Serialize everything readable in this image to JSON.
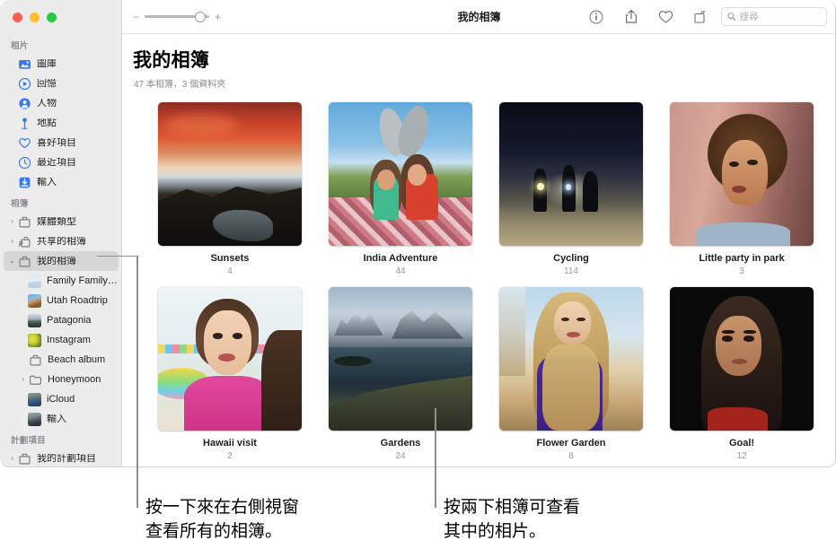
{
  "window": {
    "traffic_lights": [
      "close",
      "minimize",
      "zoom"
    ]
  },
  "toolbar": {
    "zoom_minus": "−",
    "zoom_plus": "+",
    "title": "我的相簿",
    "info_label": "info",
    "share_label": "share",
    "favorite_label": "favorite",
    "rotate_label": "rotate",
    "search_placeholder": "搜尋",
    "search_value": ""
  },
  "sidebar": {
    "sections": [
      {
        "header": "相片",
        "items": [
          {
            "label": "圖庫",
            "icon": "library-icon",
            "triangle": "",
            "selected": false
          },
          {
            "label": "回憶",
            "icon": "memories-icon",
            "triangle": "",
            "selected": false
          },
          {
            "label": "人物",
            "icon": "people-icon",
            "triangle": "",
            "selected": false
          },
          {
            "label": "地點",
            "icon": "places-icon",
            "triangle": "",
            "selected": false
          },
          {
            "label": "喜好項目",
            "icon": "heart-icon",
            "triangle": "",
            "selected": false
          },
          {
            "label": "最近項目",
            "icon": "clock-icon",
            "triangle": "",
            "selected": false
          },
          {
            "label": "輸入",
            "icon": "import-icon",
            "triangle": "",
            "selected": false
          }
        ]
      },
      {
        "header": "相簿",
        "items": [
          {
            "label": "媒體類型",
            "icon": "album-outline-icon",
            "triangle": "›",
            "selected": false
          },
          {
            "label": "共享的相簿",
            "icon": "shared-album-icon",
            "triangle": "›",
            "selected": false
          },
          {
            "label": "我的相簿",
            "icon": "album-outline-icon",
            "triangle": "⌄",
            "selected": true
          },
          {
            "label": "Family Family…",
            "icon": "photo-thumb-family",
            "triangle": "",
            "selected": false,
            "indent": true
          },
          {
            "label": "Utah Roadtrip",
            "icon": "photo-thumb-utah",
            "triangle": "",
            "selected": false,
            "indent": true
          },
          {
            "label": "Patagonia",
            "icon": "photo-thumb-patagonia",
            "triangle": "",
            "selected": false,
            "indent": true
          },
          {
            "label": "Instagram",
            "icon": "photo-thumb-instagram",
            "triangle": "",
            "selected": false,
            "indent": true
          },
          {
            "label": "Beach album",
            "icon": "album-outline-icon",
            "triangle": "",
            "selected": false,
            "indent": true
          },
          {
            "label": "Honeymoon",
            "icon": "folder-icon",
            "triangle": "›",
            "selected": false,
            "indent": true
          },
          {
            "label": "iCloud",
            "icon": "photo-thumb-icloud",
            "triangle": "",
            "selected": false,
            "indent": true
          },
          {
            "label": "輸入",
            "icon": "photo-thumb-import",
            "triangle": "",
            "selected": false,
            "indent": true
          }
        ]
      },
      {
        "header": "計劃項目",
        "items": [
          {
            "label": "我的計劃項目",
            "icon": "album-outline-icon",
            "triangle": "›",
            "selected": false
          }
        ]
      }
    ]
  },
  "main": {
    "title": "我的相簿",
    "subtitle": "47 本相簿，3 個資料夾",
    "albums": [
      {
        "name": "Sunsets",
        "count": "4",
        "thumb": "sunset-landscape"
      },
      {
        "name": "India Adventure",
        "count": "44",
        "thumb": "kids-picnic"
      },
      {
        "name": "Cycling",
        "count": "114",
        "thumb": "night-cyclists"
      },
      {
        "name": "Little party in park",
        "count": "3",
        "thumb": "curly-woman-portrait"
      },
      {
        "name": "Hawaii visit",
        "count": "2",
        "thumb": "girl-pink-dress"
      },
      {
        "name": "Gardens",
        "count": "24",
        "thumb": "patagonia-lake"
      },
      {
        "name": "Flower Garden",
        "count": "8",
        "thumb": "blonde-curly-woman"
      },
      {
        "name": "Goal!",
        "count": "12",
        "thumb": "dark-portrait"
      }
    ]
  },
  "callouts": [
    {
      "line1": "按一下來在右側視窗",
      "line2": "查看所有的相簿。"
    },
    {
      "line1": "按兩下相簿可查看",
      "line2": "其中的相片。"
    }
  ],
  "colors": {
    "accent": "#3478f6",
    "sidebar_bg": "#ececec",
    "selection": "#d6d6d6",
    "leader": "#8e8e93"
  }
}
